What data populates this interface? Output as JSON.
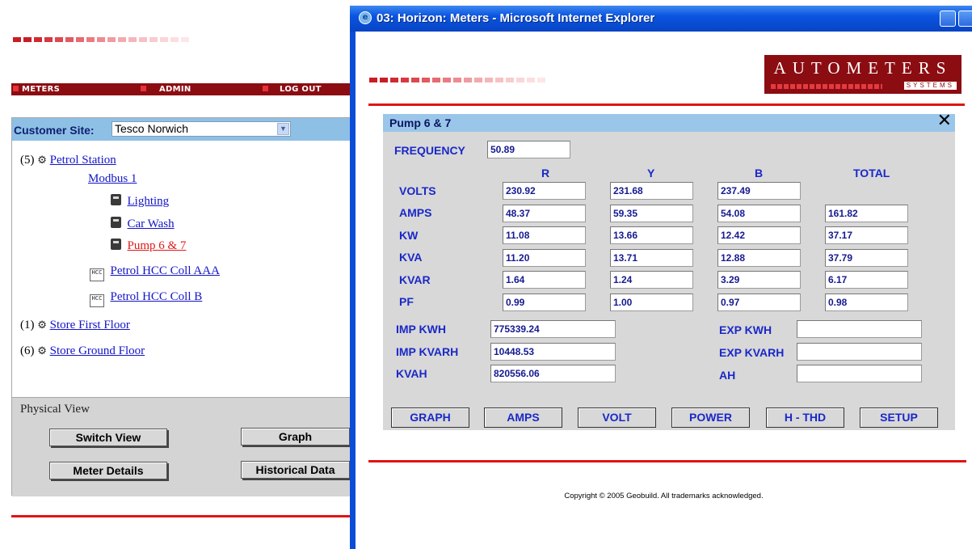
{
  "left": {
    "nav": {
      "meters": "METERS",
      "admin": "ADMIN",
      "logout": "LOG OUT"
    },
    "site": {
      "label": "Customer Site:",
      "value": "Tesco Norwich"
    },
    "tree": {
      "petrol_count": "(5)",
      "petrol_station": "Petrol Station",
      "modbus": "Modbus 1",
      "lighting": "Lighting",
      "carwash": "Car Wash",
      "pump": "Pump 6 & 7",
      "hcc_a_icon": "HCC",
      "hcc_a": "Petrol HCC Coll AAA",
      "hcc_b_icon": "HCC",
      "hcc_b": "Petrol HCC Coll B",
      "first_count": "(1)",
      "first_floor": "Store First Floor",
      "ground_count": "(6)",
      "ground_floor": "Store Ground Floor"
    },
    "physical": {
      "label": "Physical View",
      "switch_view": "Switch View",
      "graph": "Graph",
      "meter_details": "Meter Details",
      "historical": "Historical Data"
    }
  },
  "ie": {
    "title": "03: Horizon: Meters - Microsoft Internet Explorer",
    "logo": {
      "name": "AUTOMETERS",
      "sub": "SYSTEMS"
    },
    "panel": {
      "title": "Pump 6 & 7",
      "frequency_label": "FREQUENCY",
      "frequency": "50.89",
      "cols": {
        "r": "R",
        "y": "Y",
        "b": "B",
        "total": "TOTAL"
      },
      "rows": [
        {
          "label": "VOLTS",
          "r": "230.92",
          "y": "231.68",
          "b": "237.49",
          "total": ""
        },
        {
          "label": "AMPS",
          "r": "48.37",
          "y": "59.35",
          "b": "54.08",
          "total": "161.82"
        },
        {
          "label": "KW",
          "r": "11.08",
          "y": "13.66",
          "b": "12.42",
          "total": "37.17"
        },
        {
          "label": "KVA",
          "r": "11.20",
          "y": "13.71",
          "b": "12.88",
          "total": "37.79"
        },
        {
          "label": "KVAR",
          "r": "1.64",
          "y": "1.24",
          "b": "3.29",
          "total": "6.17"
        },
        {
          "label": "PF",
          "r": "0.99",
          "y": "1.00",
          "b": "0.97",
          "total": "0.98"
        }
      ],
      "energy": {
        "imp_kwh_label": "IMP KWH",
        "imp_kwh": "775339.24",
        "imp_kvarh_label": "IMP KVARH",
        "imp_kvarh": "10448.53",
        "kvah_label": "KVAH",
        "kvah": "820556.06",
        "exp_kwh_label": "EXP KWH",
        "exp_kwh": "",
        "exp_kvarh_label": "EXP KVARH",
        "exp_kvarh": "",
        "ah_label": "AH",
        "ah": ""
      },
      "buttons": {
        "graph": "GRAPH",
        "amps": "AMPS",
        "volt": "VOLT",
        "power": "POWER",
        "hthd": "H - THD",
        "setup": "SETUP"
      }
    },
    "copyright": "Copyright © 2005 Geobuild. All trademarks acknowledged."
  },
  "colors": {
    "brand_red": "#8b0d12",
    "accent_red": "#e01414",
    "label_blue": "#1a28c8",
    "xp_blue": "#0b4cd8"
  }
}
